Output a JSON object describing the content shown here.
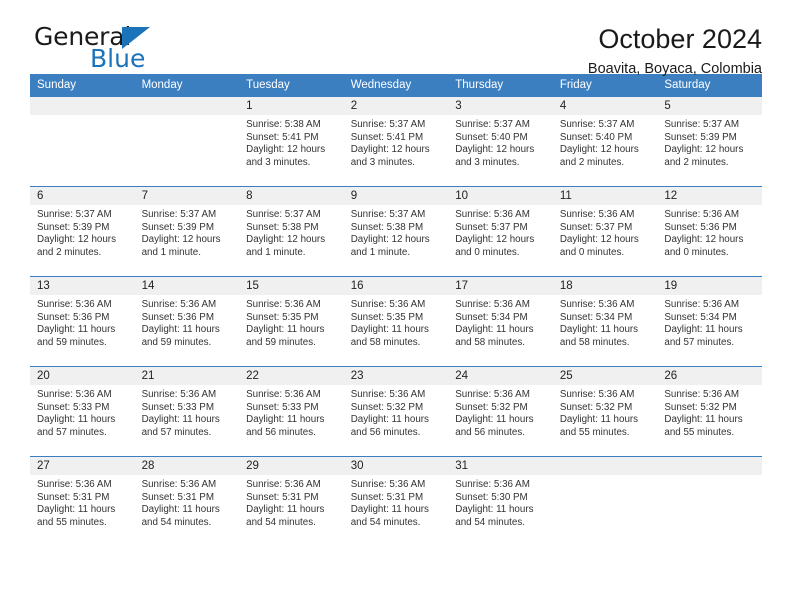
{
  "brand": {
    "name_part1": "General",
    "name_part2": "Blue",
    "triangle_icon": "blue-triangle-icon",
    "accent_color": "#1b73ba"
  },
  "header": {
    "title": "October 2024",
    "subtitle": "Boavita, Boyaca, Colombia"
  },
  "theme": {
    "header_row_bg": "#3c7fc1",
    "daynum_bg": "#f0f0f0",
    "row_divider": "#3c7fc1",
    "text": "#333333"
  },
  "weekday_headers": [
    "Sunday",
    "Monday",
    "Tuesday",
    "Wednesday",
    "Thursday",
    "Friday",
    "Saturday"
  ],
  "labels": {
    "sunrise_prefix": "Sunrise:",
    "sunset_prefix": "Sunset:",
    "daylight_prefix": "Daylight:"
  },
  "weeks": [
    [
      {
        "day": "",
        "empty": true,
        "sunrise": "",
        "sunset": "",
        "daylight_line1": "",
        "daylight_line2": ""
      },
      {
        "day": "",
        "empty": true,
        "sunrise": "",
        "sunset": "",
        "daylight_line1": "",
        "daylight_line2": ""
      },
      {
        "day": "1",
        "sunrise": "Sunrise: 5:38 AM",
        "sunset": "Sunset: 5:41 PM",
        "daylight_line1": "Daylight: 12 hours",
        "daylight_line2": "and 3 minutes."
      },
      {
        "day": "2",
        "sunrise": "Sunrise: 5:37 AM",
        "sunset": "Sunset: 5:41 PM",
        "daylight_line1": "Daylight: 12 hours",
        "daylight_line2": "and 3 minutes."
      },
      {
        "day": "3",
        "sunrise": "Sunrise: 5:37 AM",
        "sunset": "Sunset: 5:40 PM",
        "daylight_line1": "Daylight: 12 hours",
        "daylight_line2": "and 3 minutes."
      },
      {
        "day": "4",
        "sunrise": "Sunrise: 5:37 AM",
        "sunset": "Sunset: 5:40 PM",
        "daylight_line1": "Daylight: 12 hours",
        "daylight_line2": "and 2 minutes."
      },
      {
        "day": "5",
        "sunrise": "Sunrise: 5:37 AM",
        "sunset": "Sunset: 5:39 PM",
        "daylight_line1": "Daylight: 12 hours",
        "daylight_line2": "and 2 minutes."
      }
    ],
    [
      {
        "day": "6",
        "sunrise": "Sunrise: 5:37 AM",
        "sunset": "Sunset: 5:39 PM",
        "daylight_line1": "Daylight: 12 hours",
        "daylight_line2": "and 2 minutes."
      },
      {
        "day": "7",
        "sunrise": "Sunrise: 5:37 AM",
        "sunset": "Sunset: 5:39 PM",
        "daylight_line1": "Daylight: 12 hours",
        "daylight_line2": "and 1 minute."
      },
      {
        "day": "8",
        "sunrise": "Sunrise: 5:37 AM",
        "sunset": "Sunset: 5:38 PM",
        "daylight_line1": "Daylight: 12 hours",
        "daylight_line2": "and 1 minute."
      },
      {
        "day": "9",
        "sunrise": "Sunrise: 5:37 AM",
        "sunset": "Sunset: 5:38 PM",
        "daylight_line1": "Daylight: 12 hours",
        "daylight_line2": "and 1 minute."
      },
      {
        "day": "10",
        "sunrise": "Sunrise: 5:36 AM",
        "sunset": "Sunset: 5:37 PM",
        "daylight_line1": "Daylight: 12 hours",
        "daylight_line2": "and 0 minutes."
      },
      {
        "day": "11",
        "sunrise": "Sunrise: 5:36 AM",
        "sunset": "Sunset: 5:37 PM",
        "daylight_line1": "Daylight: 12 hours",
        "daylight_line2": "and 0 minutes."
      },
      {
        "day": "12",
        "sunrise": "Sunrise: 5:36 AM",
        "sunset": "Sunset: 5:36 PM",
        "daylight_line1": "Daylight: 12 hours",
        "daylight_line2": "and 0 minutes."
      }
    ],
    [
      {
        "day": "13",
        "sunrise": "Sunrise: 5:36 AM",
        "sunset": "Sunset: 5:36 PM",
        "daylight_line1": "Daylight: 11 hours",
        "daylight_line2": "and 59 minutes."
      },
      {
        "day": "14",
        "sunrise": "Sunrise: 5:36 AM",
        "sunset": "Sunset: 5:36 PM",
        "daylight_line1": "Daylight: 11 hours",
        "daylight_line2": "and 59 minutes."
      },
      {
        "day": "15",
        "sunrise": "Sunrise: 5:36 AM",
        "sunset": "Sunset: 5:35 PM",
        "daylight_line1": "Daylight: 11 hours",
        "daylight_line2": "and 59 minutes."
      },
      {
        "day": "16",
        "sunrise": "Sunrise: 5:36 AM",
        "sunset": "Sunset: 5:35 PM",
        "daylight_line1": "Daylight: 11 hours",
        "daylight_line2": "and 58 minutes."
      },
      {
        "day": "17",
        "sunrise": "Sunrise: 5:36 AM",
        "sunset": "Sunset: 5:34 PM",
        "daylight_line1": "Daylight: 11 hours",
        "daylight_line2": "and 58 minutes."
      },
      {
        "day": "18",
        "sunrise": "Sunrise: 5:36 AM",
        "sunset": "Sunset: 5:34 PM",
        "daylight_line1": "Daylight: 11 hours",
        "daylight_line2": "and 58 minutes."
      },
      {
        "day": "19",
        "sunrise": "Sunrise: 5:36 AM",
        "sunset": "Sunset: 5:34 PM",
        "daylight_line1": "Daylight: 11 hours",
        "daylight_line2": "and 57 minutes."
      }
    ],
    [
      {
        "day": "20",
        "sunrise": "Sunrise: 5:36 AM",
        "sunset": "Sunset: 5:33 PM",
        "daylight_line1": "Daylight: 11 hours",
        "daylight_line2": "and 57 minutes."
      },
      {
        "day": "21",
        "sunrise": "Sunrise: 5:36 AM",
        "sunset": "Sunset: 5:33 PM",
        "daylight_line1": "Daylight: 11 hours",
        "daylight_line2": "and 57 minutes."
      },
      {
        "day": "22",
        "sunrise": "Sunrise: 5:36 AM",
        "sunset": "Sunset: 5:33 PM",
        "daylight_line1": "Daylight: 11 hours",
        "daylight_line2": "and 56 minutes."
      },
      {
        "day": "23",
        "sunrise": "Sunrise: 5:36 AM",
        "sunset": "Sunset: 5:32 PM",
        "daylight_line1": "Daylight: 11 hours",
        "daylight_line2": "and 56 minutes."
      },
      {
        "day": "24",
        "sunrise": "Sunrise: 5:36 AM",
        "sunset": "Sunset: 5:32 PM",
        "daylight_line1": "Daylight: 11 hours",
        "daylight_line2": "and 56 minutes."
      },
      {
        "day": "25",
        "sunrise": "Sunrise: 5:36 AM",
        "sunset": "Sunset: 5:32 PM",
        "daylight_line1": "Daylight: 11 hours",
        "daylight_line2": "and 55 minutes."
      },
      {
        "day": "26",
        "sunrise": "Sunrise: 5:36 AM",
        "sunset": "Sunset: 5:32 PM",
        "daylight_line1": "Daylight: 11 hours",
        "daylight_line2": "and 55 minutes."
      }
    ],
    [
      {
        "day": "27",
        "sunrise": "Sunrise: 5:36 AM",
        "sunset": "Sunset: 5:31 PM",
        "daylight_line1": "Daylight: 11 hours",
        "daylight_line2": "and 55 minutes."
      },
      {
        "day": "28",
        "sunrise": "Sunrise: 5:36 AM",
        "sunset": "Sunset: 5:31 PM",
        "daylight_line1": "Daylight: 11 hours",
        "daylight_line2": "and 54 minutes."
      },
      {
        "day": "29",
        "sunrise": "Sunrise: 5:36 AM",
        "sunset": "Sunset: 5:31 PM",
        "daylight_line1": "Daylight: 11 hours",
        "daylight_line2": "and 54 minutes."
      },
      {
        "day": "30",
        "sunrise": "Sunrise: 5:36 AM",
        "sunset": "Sunset: 5:31 PM",
        "daylight_line1": "Daylight: 11 hours",
        "daylight_line2": "and 54 minutes."
      },
      {
        "day": "31",
        "sunrise": "Sunrise: 5:36 AM",
        "sunset": "Sunset: 5:30 PM",
        "daylight_line1": "Daylight: 11 hours",
        "daylight_line2": "and 54 minutes."
      },
      {
        "day": "",
        "empty": true,
        "sunrise": "",
        "sunset": "",
        "daylight_line1": "",
        "daylight_line2": ""
      },
      {
        "day": "",
        "empty": true,
        "sunrise": "",
        "sunset": "",
        "daylight_line1": "",
        "daylight_line2": ""
      }
    ]
  ]
}
